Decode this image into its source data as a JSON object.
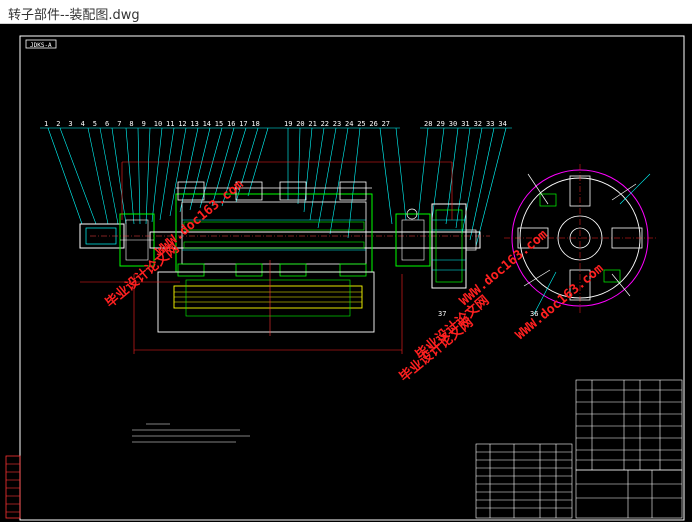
{
  "window": {
    "title": "转子部件--装配图.dwg"
  },
  "drawing": {
    "frame_label": "JDKS-A",
    "part_numbers_left": [
      "1",
      "2",
      "3",
      "4",
      "5",
      "6",
      "7",
      "8",
      "9",
      "10",
      "11",
      "12",
      "13",
      "14",
      "15",
      "16",
      "17",
      "18"
    ],
    "part_numbers_mid": [
      "19",
      "20",
      "21",
      "22",
      "23",
      "24",
      "25",
      "26",
      "27"
    ],
    "part_numbers_right": [
      "28",
      "29",
      "30",
      "31",
      "32",
      "33",
      "34"
    ],
    "part_number_bottom": "37",
    "part_number_disc": "36",
    "watermarks": {
      "site_text": "WWW.doc163.com",
      "site_text_2": "WWW.doc163.com",
      "site_text_3": "WWW.doc163.com",
      "cn_text": "毕业设计论文网",
      "cn_text_2": "毕业设计论文网",
      "cn_text_3": "毕业设计论文网"
    },
    "colors": {
      "background": "#000000",
      "frame": "#ffffff",
      "leader": "#00ffff",
      "part": "#00ff00",
      "dimension": "#ff0000",
      "highlight": "#ffff00",
      "circle": "#ff00ff",
      "watermark": "#ff2020"
    }
  }
}
